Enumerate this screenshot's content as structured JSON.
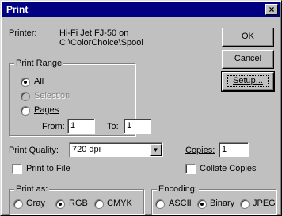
{
  "window": {
    "title": "Print",
    "close_glyph": "×"
  },
  "printer": {
    "label": "Printer:",
    "name": "Hi-Fi Jet FJ-50 on",
    "path": "C:\\ColorChoice\\Spool"
  },
  "buttons": {
    "ok": "OK",
    "cancel": "Cancel",
    "setup": "Setup..."
  },
  "print_range": {
    "title": "Print Range",
    "all": "All",
    "selection": "Selection",
    "pages": "Pages",
    "from_label": "From:",
    "from_value": "1",
    "to_label": "To:",
    "to_value": "1",
    "selected": "all"
  },
  "print_quality": {
    "label": "Print Quality:",
    "value": "720 dpi",
    "arrow_icon": "chevron-down-icon"
  },
  "copies": {
    "label": "Copies:",
    "value": "1"
  },
  "print_to_file": {
    "label": "Print to File",
    "checked": false
  },
  "collate": {
    "label": "Collate Copies",
    "checked": false
  },
  "print_as": {
    "title": "Print as:",
    "gray": "Gray",
    "rgb": "RGB",
    "cmyk": "CMYK",
    "selected": "rgb"
  },
  "encoding": {
    "title": "Encoding:",
    "ascii": "ASCII",
    "binary": "Binary",
    "jpeg": "JPEG",
    "selected": "binary"
  }
}
